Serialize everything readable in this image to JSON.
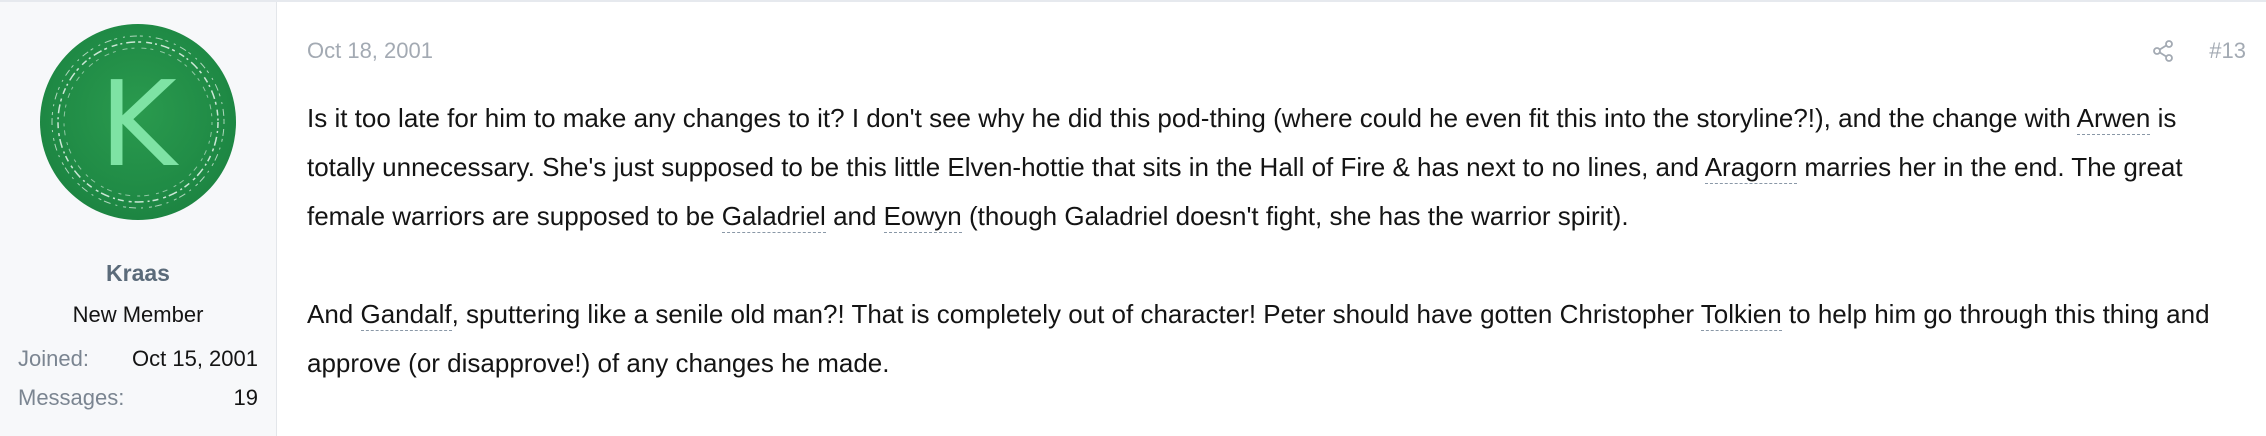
{
  "user": {
    "avatar_letter": "K",
    "name": "Kraas",
    "title": "New Member",
    "stats": [
      {
        "label": "Joined:",
        "value": "Oct 15, 2001"
      },
      {
        "label": "Messages:",
        "value": "19"
      }
    ]
  },
  "post": {
    "date": "Oct 18, 2001",
    "number": "#13",
    "icons": {
      "share": "share-icon"
    },
    "p1": {
      "t1": "Is it too late for him to make any changes to it? I don't see why he did this pod-thing (where could he even fit this into the storyline?!), and the change with ",
      "arwen": "Arwen",
      "t2": " is totally unnecessary. She's just supposed to be this little Elven-hottie that sits in the Hall of Fire & has next to no lines, and ",
      "aragorn": "Aragorn",
      "t3": " marries her in the end. The great female warriors are supposed to be ",
      "galadriel": "Galadriel",
      "t4": " and ",
      "eowyn": "Eowyn",
      "t5": " (though Galadriel doesn't fight, she has the warrior spirit)."
    },
    "p2": {
      "t1": "And ",
      "gandalf": "Gandalf",
      "t2": ", sputtering like a senile old man?! That is completely out of character! Peter should have gotten Christopher ",
      "tolkien": "Tolkien",
      "t3": " to help him go through this thing and approve (or disapprove!) of any changes he made."
    }
  },
  "colors": {
    "avatar_bg": "#1f8a45",
    "avatar_letter": "#7ee3a4",
    "username": "#5b6b7a",
    "muted": "#a3aab3",
    "sidebar_bg": "#f7f8fa"
  }
}
